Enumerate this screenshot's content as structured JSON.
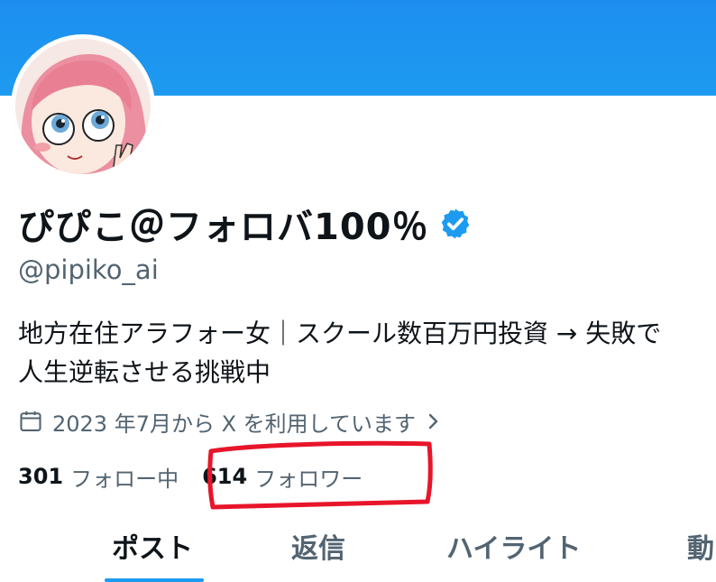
{
  "profile": {
    "display_name": "ぴぴこ＠フォロバ100％",
    "handle": "@pipiko_ai",
    "bio_line1": "地方在住アラフォー女｜スクール数百万円投資 → 失敗で",
    "bio_line2": "人生逆転させる挑戦中",
    "joined": "2023 年7月から X を利用しています",
    "verified_icon": "verified-badge-icon",
    "avatar": "avatar-illustration"
  },
  "stats": {
    "following_count": "301",
    "following_label": "フォロー中",
    "followers_count": "614",
    "followers_label": "フォロワー"
  },
  "tabs": [
    {
      "label": "ポスト",
      "active": true
    },
    {
      "label": "返信",
      "active": false
    },
    {
      "label": "ハイライト",
      "active": false
    },
    {
      "label": "動",
      "active": false
    }
  ],
  "colors": {
    "accent": "#1d9bf0",
    "text": "#0f1419",
    "secondary_text": "#536471",
    "annotation": "#e8152a"
  }
}
